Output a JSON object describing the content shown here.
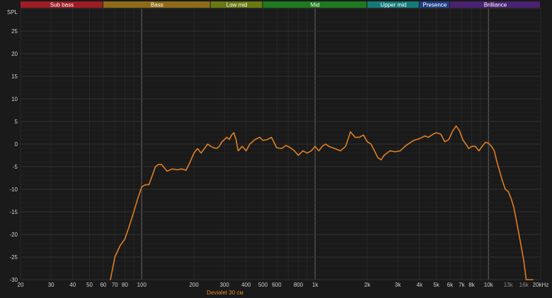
{
  "chart_data": {
    "type": "line",
    "ylabel": "SPL",
    "x_scale": "log",
    "xlim": [
      20,
      20000
    ],
    "ylim": [
      -30,
      30
    ],
    "grid": true,
    "colors": {
      "background": "#1a1a1a",
      "grid": "#2c2c2c",
      "grid_major": "#5a5a5a",
      "line": "#e07f22"
    },
    "bands": [
      {
        "label": "Sub bass",
        "from": 20,
        "to": 60,
        "color": "#a01c24"
      },
      {
        "label": "Bass",
        "from": 60,
        "to": 250,
        "color": "#8f6a17"
      },
      {
        "label": "Low mid",
        "from": 250,
        "to": 500,
        "color": "#6a7a10"
      },
      {
        "label": "Mid",
        "from": 500,
        "to": 2000,
        "color": "#1d7a1d"
      },
      {
        "label": "Upper mid",
        "from": 2000,
        "to": 4000,
        "color": "#137a7a"
      },
      {
        "label": "Presence",
        "from": 4000,
        "to": 6000,
        "color": "#1f3f8a"
      },
      {
        "label": "Brilliance",
        "from": 6000,
        "to": 20000,
        "color": "#4a2270"
      }
    ],
    "x_ticks": [
      {
        "value": 20,
        "label": "20"
      },
      {
        "value": 30,
        "label": "30"
      },
      {
        "value": 40,
        "label": "40"
      },
      {
        "value": 50,
        "label": "50"
      },
      {
        "value": 60,
        "label": "60"
      },
      {
        "value": 70,
        "label": "70"
      },
      {
        "value": 80,
        "label": "80"
      },
      {
        "value": 100,
        "label": "100"
      },
      {
        "value": 200,
        "label": "200"
      },
      {
        "value": 300,
        "label": "300"
      },
      {
        "value": 400,
        "label": "400"
      },
      {
        "value": 500,
        "label": "500"
      },
      {
        "value": 600,
        "label": "600"
      },
      {
        "value": 800,
        "label": "800"
      },
      {
        "value": 1000,
        "label": "1k"
      },
      {
        "value": 2000,
        "label": "2k"
      },
      {
        "value": 3000,
        "label": "3k"
      },
      {
        "value": 4000,
        "label": "4k"
      },
      {
        "value": 5000,
        "label": "5k"
      },
      {
        "value": 6000,
        "label": "6k"
      },
      {
        "value": 7000,
        "label": "7k"
      },
      {
        "value": 8000,
        "label": "8k"
      },
      {
        "value": 10000,
        "label": "10k"
      },
      {
        "value": 13000,
        "label": "13k",
        "dim": true
      },
      {
        "value": 16000,
        "label": "16k",
        "dim": true
      },
      {
        "value": 20000,
        "label": "20kHz"
      }
    ],
    "y_ticks": [
      25,
      20,
      15,
      10,
      5,
      0,
      -5,
      -10,
      -15,
      -20,
      -25,
      -30
    ],
    "series": [
      {
        "name": "Devialet 30 см",
        "color": "#e07f22",
        "x": [
          66,
          70,
          75,
          80,
          85,
          90,
          95,
          100,
          105,
          110,
          115,
          120,
          125,
          130,
          140,
          150,
          160,
          170,
          180,
          190,
          200,
          210,
          220,
          230,
          240,
          250,
          260,
          270,
          280,
          290,
          300,
          310,
          320,
          330,
          340,
          350,
          360,
          370,
          380,
          400,
          420,
          450,
          480,
          500,
          530,
          560,
          600,
          640,
          680,
          720,
          760,
          800,
          850,
          900,
          950,
          1000,
          1050,
          1100,
          1150,
          1200,
          1300,
          1400,
          1500,
          1600,
          1700,
          1800,
          1900,
          2000,
          2100,
          2200,
          2300,
          2400,
          2500,
          2700,
          2900,
          3100,
          3300,
          3500,
          3700,
          4000,
          4300,
          4500,
          4800,
          5000,
          5300,
          5600,
          5900,
          6200,
          6500,
          6800,
          7100,
          7400,
          7700,
          8000,
          8400,
          8800,
          9200,
          9600,
          10000,
          10400,
          10800,
          11200,
          11600,
          12000,
          12500,
          13000,
          13500,
          14000,
          14500,
          15000,
          15500,
          16000,
          16500,
          17000,
          17500,
          18000
        ],
        "y": [
          -30,
          -25,
          -22.5,
          -21,
          -18,
          -15,
          -12,
          -9.5,
          -9,
          -9,
          -7,
          -5,
          -4.5,
          -4.5,
          -6,
          -5.5,
          -5.7,
          -5.5,
          -5.8,
          -4,
          -2,
          -1,
          -2,
          -1,
          0,
          -0.5,
          -0.8,
          -1,
          -0.5,
          0.5,
          1,
          1.5,
          1,
          2,
          2.5,
          1,
          -1.5,
          -1,
          -0.5,
          -1.5,
          0,
          1,
          1.5,
          0.8,
          1,
          1.5,
          -0.8,
          -1,
          -0.3,
          -0.8,
          -1.5,
          -2.5,
          -1.5,
          -2,
          -1.5,
          -0.5,
          -1.5,
          -0.5,
          0,
          -0.5,
          -1,
          -1.5,
          -0.5,
          2.7,
          1.5,
          1.5,
          2,
          0.5,
          0,
          -1.5,
          -3,
          -3.5,
          -2.5,
          -1.5,
          -1.7,
          -1.5,
          -0.5,
          0.2,
          0.8,
          1.2,
          1.8,
          1.5,
          2.2,
          2.5,
          2.2,
          0.5,
          1,
          2.8,
          4,
          3,
          1,
          0,
          -1,
          -0.5,
          -0.5,
          -1.5,
          -0.5,
          0.4,
          0.2,
          -0.5,
          -1.5,
          -4,
          -6,
          -8,
          -10,
          -10.5,
          -12,
          -14,
          -17,
          -20,
          -23,
          -26,
          -30,
          -30,
          -30,
          -30
        ]
      }
    ]
  }
}
